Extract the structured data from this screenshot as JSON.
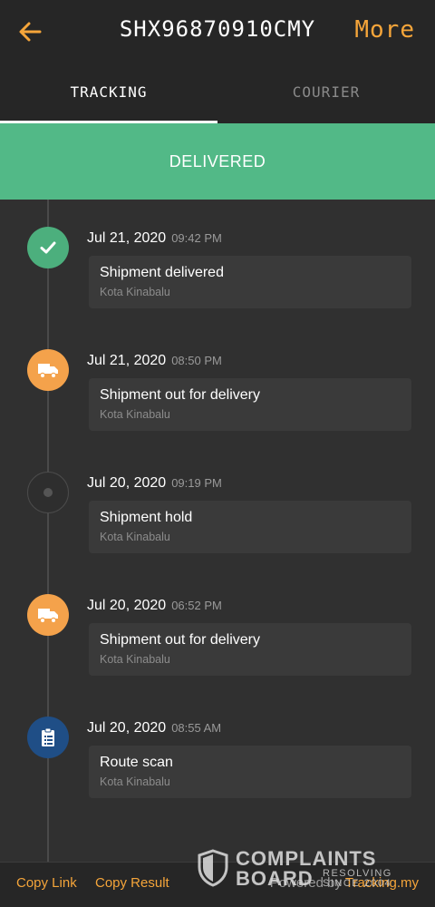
{
  "header": {
    "back_icon": "arrow-left-icon",
    "title": "SHX96870910CMY",
    "more_label": "More",
    "accent_color": "#f5a53a"
  },
  "tabs": [
    {
      "label": "TRACKING",
      "active": true
    },
    {
      "label": "COURIER",
      "active": false
    }
  ],
  "status": {
    "label": "DELIVERED",
    "color": "#52b987"
  },
  "events": [
    {
      "date": "Jul 21, 2020",
      "time": "09:42 PM",
      "title": "Shipment delivered",
      "location": "Kota Kinabalu",
      "icon": "check-icon",
      "color": "green"
    },
    {
      "date": "Jul 21, 2020",
      "time": "08:50 PM",
      "title": "Shipment out for delivery",
      "location": "Kota Kinabalu",
      "icon": "truck-icon",
      "color": "orange"
    },
    {
      "date": "Jul 20, 2020",
      "time": "09:19 PM",
      "title": "Shipment hold",
      "location": "Kota Kinabalu",
      "icon": "dot-icon",
      "color": "grey"
    },
    {
      "date": "Jul 20, 2020",
      "time": "06:52 PM",
      "title": "Shipment out for delivery",
      "location": "Kota Kinabalu",
      "icon": "truck-icon",
      "color": "orange"
    },
    {
      "date": "Jul 20, 2020",
      "time": "08:55 AM",
      "title": "Route scan",
      "location": "Kota Kinabalu",
      "icon": "clipboard-icon",
      "color": "blue"
    }
  ],
  "bottom": {
    "copy_link": "Copy Link",
    "copy_result": "Copy Result",
    "powered_by": "Powered by",
    "brand": "Tracking.my"
  },
  "watermark": {
    "line1": "COMPLAINTS",
    "line2": "BOARD",
    "sub1": "RESOLVING",
    "sub2": "SINCE 2004"
  }
}
